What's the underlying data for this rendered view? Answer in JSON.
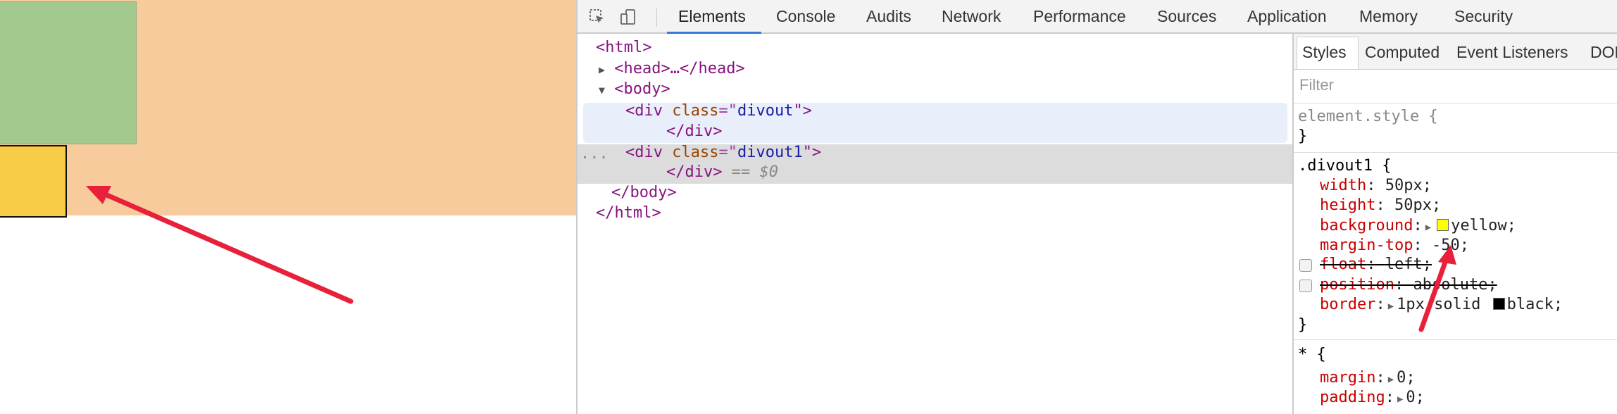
{
  "devtools": {
    "tabs": [
      "Elements",
      "Console",
      "Audits",
      "Network",
      "Performance",
      "Sources",
      "Application",
      "Memory",
      "Security"
    ],
    "active_tab": "Elements"
  },
  "dom_tree": {
    "html_open": "<html>",
    "head": "<head>…</head>",
    "body_open": "<body>",
    "div1_open_pre": "<div ",
    "div1_attr_name": "class",
    "div1_attr_eq": "=\"",
    "div1_attr_value": "divout",
    "div1_attr_close": "\">",
    "div1_close": "</div>",
    "div2_attr_value": "divout1",
    "div2_close": "</div>",
    "div2_suffix": "== $0",
    "body_close": "</body>",
    "html_close": "</html>",
    "ellipsis": "···"
  },
  "styles_pane": {
    "tabs": [
      "Styles",
      "Computed",
      "Event Listeners",
      "DOM"
    ],
    "filter_placeholder": "Filter",
    "element_style_open": "element.style {",
    "close_brace": "}",
    "rule1_selector": ".divout1 {",
    "rule1": [
      {
        "prop": "width",
        "val": "50px;"
      },
      {
        "prop": "height",
        "val": "50px;"
      },
      {
        "prop": "background",
        "val": "yellow;"
      },
      {
        "prop": "margin-top",
        "val": "-50;"
      },
      {
        "prop": "float",
        "val": "left;"
      },
      {
        "prop": "position",
        "val": "absolute;"
      },
      {
        "prop": "border",
        "val": "1px solid ",
        "val2": "black;"
      }
    ],
    "rule2_selector": "* {",
    "rule2": [
      {
        "prop": "margin",
        "val": "0;"
      },
      {
        "prop": "padding",
        "val": "0;"
      }
    ]
  },
  "colors": {
    "divout_bg": "#f8cb9c",
    "green_box": "#a3c98f",
    "yellow_box": "#f8cc46",
    "annotation_arrow": "#e8203a",
    "active_tab_underline": "#3879d9"
  }
}
